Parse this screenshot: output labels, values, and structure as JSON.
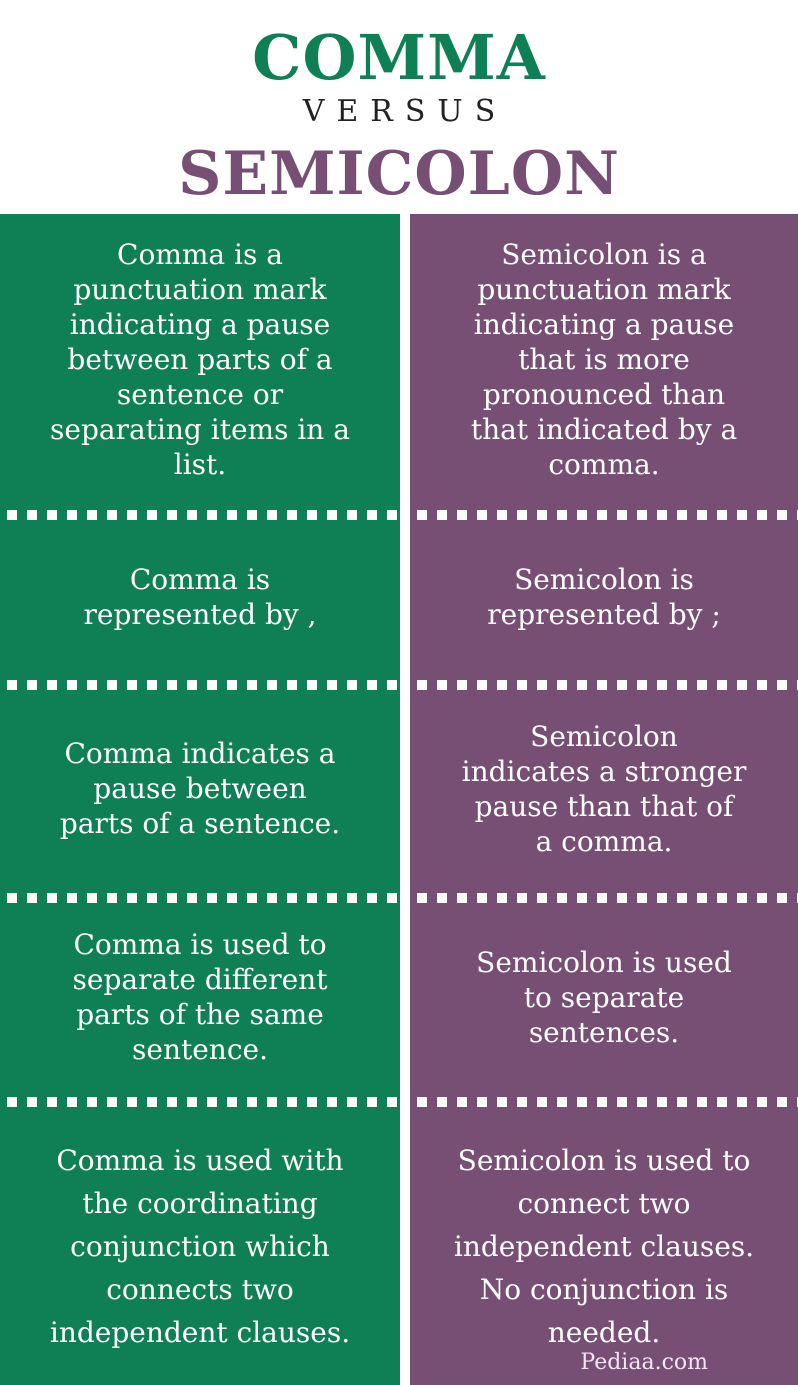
{
  "header": {
    "title_a": "COMMA",
    "versus": "VERSUS",
    "title_b": "SEMICOLON"
  },
  "colors": {
    "comma": "#0f7f56",
    "semicolon": "#774f74"
  },
  "rows": [
    {
      "comma": [
        "Comma is a",
        "punctuation mark",
        "indicating a pause",
        "between parts of a",
        "sentence or",
        "separating items in a",
        "list."
      ],
      "semicolon": [
        "Semicolon is a",
        "punctuation mark",
        "indicating a pause",
        "that is more",
        "pronounced than",
        "that indicated by a",
        "comma."
      ]
    },
    {
      "comma": [
        "Comma is",
        "represented by ,"
      ],
      "semicolon": [
        "Semicolon is",
        "represented by ;"
      ]
    },
    {
      "comma": [
        "Comma indicates a",
        "pause between",
        "parts of a sentence."
      ],
      "semicolon": [
        "Semicolon",
        "indicates a stronger",
        "pause than that of",
        "a comma."
      ]
    },
    {
      "comma": [
        "Comma is used to",
        "separate different",
        "parts of the same",
        "sentence."
      ],
      "semicolon": [
        "Semicolon is used",
        "to separate",
        "sentences."
      ]
    },
    {
      "comma": [
        "Comma is used with",
        "the coordinating",
        "conjunction which",
        "connects two",
        "independent clauses."
      ],
      "semicolon": [
        "Semicolon is used to",
        "connect two",
        "independent clauses.",
        "No conjunction is",
        "needed."
      ]
    }
  ],
  "footer": {
    "logo": "Pediaa.com"
  }
}
